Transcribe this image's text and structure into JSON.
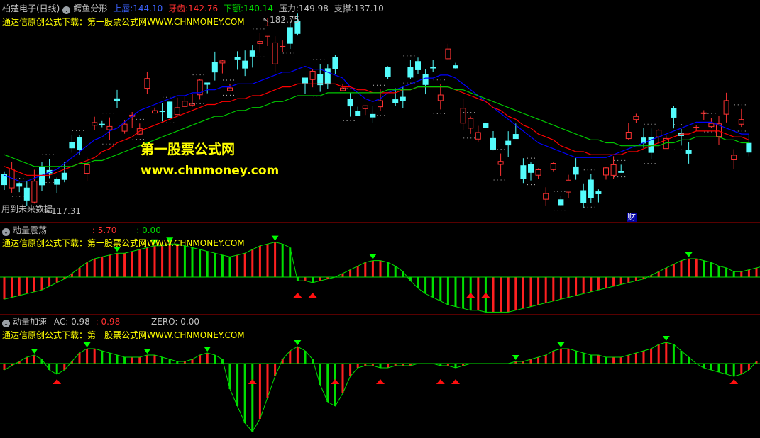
{
  "panel_main": {
    "stock": "柏楚电子(日线)",
    "indicator": "鳄鱼分形",
    "upper_label": "上唇:",
    "upper_value": "144.10",
    "teeth_label": "牙齿:",
    "teeth_value": "142.76",
    "jaw_label": "下颚:",
    "jaw_value": "140.14",
    "pressure_label": "压力:",
    "pressure_value": "149.98",
    "support_label": "支撑:",
    "support_value": "137.10",
    "subtitle": "通达信原创公式下载：第一股票公式网WWW.CHNMONEY.COM",
    "high_label": "182.75",
    "low_label": "117.31",
    "future_note": "用到未来数据",
    "finance_marker": "财",
    "watermark_cn": "第一股票公式网",
    "watermark_url": "www.chnmoney.com"
  },
  "panel_osc": {
    "title": "动量震荡",
    "v1": ": 5.70",
    "v2": ": 0.00",
    "subtitle": "通达信原创公式下载：第一股票公式网WWW.CHNMONEY.COM"
  },
  "panel_acc": {
    "title": "动量加速",
    "ac_label": "AC: 0.98",
    "v2": ": 0.98",
    "zero_label": "ZERO: 0.00",
    "subtitle": "通达信原创公式下载：第一股票公式网WWW.CHNMONEY.COM"
  },
  "colors": {
    "up": "#ff3232",
    "down": "#54fcfc",
    "lips": "#0000ff",
    "teeth": "#ff0000",
    "jaw": "#00c800",
    "pos_bar": "#ff2020",
    "neg_bar": "#00e000",
    "separator": "#b00000",
    "text": "#c0c0c0",
    "accent": "#ffff00"
  },
  "icons": {
    "panel_menu": "circle-chevron-icon"
  },
  "chart_data": [
    {
      "type": "candlestick",
      "title": "鳄鱼分形",
      "series": [
        {
          "name": "上唇",
          "values": [
            130,
            129,
            128,
            128,
            129,
            130,
            131,
            132,
            134,
            136,
            138,
            140,
            142,
            143,
            145,
            146,
            148,
            150,
            152,
            153,
            154,
            155,
            156,
            157,
            157,
            158,
            158,
            159,
            159,
            160,
            160,
            161,
            161,
            161,
            162,
            163,
            164,
            165,
            165,
            166,
            167,
            166,
            166,
            165,
            164,
            163,
            160,
            158,
            156,
            155,
            156,
            158,
            159,
            160,
            161,
            162,
            163,
            163,
            164,
            164,
            163,
            161,
            159,
            157,
            155,
            153,
            151,
            149,
            147,
            145,
            143,
            141,
            140,
            139,
            138,
            137,
            136,
            136,
            136,
            136,
            136,
            137,
            138,
            139,
            140,
            141,
            142,
            143,
            144,
            145,
            146,
            147,
            148,
            148,
            148,
            147,
            146,
            145,
            144,
            144
          ]
        },
        {
          "name": "牙齿",
          "values": [
            133,
            132,
            131,
            130,
            130,
            130,
            130,
            131,
            132,
            133,
            134,
            135,
            136,
            138,
            139,
            141,
            142,
            143,
            145,
            146,
            147,
            148,
            149,
            150,
            151,
            152,
            153,
            154,
            154,
            155,
            155,
            156,
            156,
            157,
            157,
            158,
            159,
            160,
            160,
            161,
            161,
            161,
            161,
            161,
            161,
            160,
            160,
            159,
            159,
            158,
            158,
            158,
            158,
            159,
            159,
            160,
            160,
            160,
            160,
            160,
            159,
            158,
            157,
            156,
            155,
            153,
            152,
            150,
            149,
            147,
            146,
            144,
            143,
            142,
            140,
            139,
            138,
            138,
            137,
            137,
            137,
            137,
            137,
            138,
            138,
            139,
            140,
            141,
            142,
            143,
            144,
            144,
            145,
            145,
            145,
            145,
            144,
            143,
            143,
            142
          ]
        },
        {
          "name": "下颚",
          "values": [
            137,
            136,
            135,
            134,
            133,
            133,
            133,
            133,
            133,
            133,
            134,
            134,
            135,
            135,
            136,
            137,
            138,
            139,
            140,
            141,
            142,
            143,
            144,
            145,
            146,
            147,
            148,
            149,
            150,
            150,
            151,
            152,
            152,
            153,
            153,
            154,
            155,
            155,
            156,
            157,
            157,
            157,
            157,
            158,
            158,
            158,
            158,
            158,
            158,
            158,
            158,
            159,
            159,
            159,
            159,
            160,
            160,
            160,
            160,
            160,
            159,
            159,
            158,
            157,
            156,
            155,
            154,
            153,
            152,
            151,
            150,
            149,
            148,
            147,
            146,
            145,
            144,
            143,
            142,
            142,
            141,
            141,
            140,
            140,
            140,
            140,
            140,
            140,
            141,
            141,
            142,
            142,
            143,
            143,
            143,
            143,
            142,
            142,
            141,
            141
          ]
        }
      ],
      "annotations": {
        "high": 182.75,
        "low": 117.31
      }
    },
    {
      "type": "bar",
      "title": "动量震荡",
      "values": [
        -12,
        -11,
        -10,
        -9,
        -8,
        -7,
        -5,
        -3,
        -1,
        2,
        5,
        8,
        10,
        11,
        12,
        13,
        13,
        14,
        15,
        16,
        17,
        17,
        18,
        18,
        17,
        16,
        15,
        14,
        13,
        12,
        11,
        12,
        13,
        15,
        17,
        18,
        19,
        18,
        16,
        -2,
        -2,
        -3,
        -2,
        -1,
        0,
        2,
        4,
        6,
        8,
        9,
        9,
        8,
        6,
        3,
        -2,
        -6,
        -9,
        -11,
        -13,
        -15,
        -16,
        -17,
        -18,
        -18,
        -19,
        -19,
        -19,
        -19,
        -18,
        -17,
        -16,
        -15,
        -14,
        -13,
        -12,
        -11,
        -10,
        -9,
        -8,
        -7,
        -6,
        -5,
        -4,
        -3,
        -2,
        -1,
        1,
        3,
        5,
        7,
        9,
        10,
        10,
        9,
        8,
        6,
        5,
        3,
        3,
        4,
        5,
        6
      ]
    },
    {
      "type": "bar",
      "title": "动量加速",
      "values": [
        -3,
        -1,
        1,
        3,
        4,
        2,
        -3,
        -5,
        -3,
        1,
        5,
        7,
        7,
        6,
        5,
        4,
        3,
        3,
        3,
        4,
        4,
        3,
        2,
        1,
        1,
        2,
        4,
        5,
        4,
        2,
        -12,
        -20,
        -28,
        -32,
        -26,
        -16,
        -6,
        2,
        6,
        8,
        6,
        2,
        -10,
        -18,
        -20,
        -14,
        -6,
        -2,
        -1,
        -1,
        -2,
        -2,
        -1,
        -1,
        -1,
        0,
        0,
        0,
        -1,
        -1,
        -2,
        -1,
        0,
        0,
        0,
        0,
        0,
        0,
        1,
        1,
        2,
        3,
        4,
        6,
        7,
        7,
        6,
        5,
        4,
        4,
        3,
        3,
        3,
        4,
        5,
        6,
        7,
        9,
        10,
        9,
        6,
        3,
        0,
        -2,
        -3,
        -4,
        -5,
        -6,
        -5,
        -3,
        1
      ]
    }
  ]
}
